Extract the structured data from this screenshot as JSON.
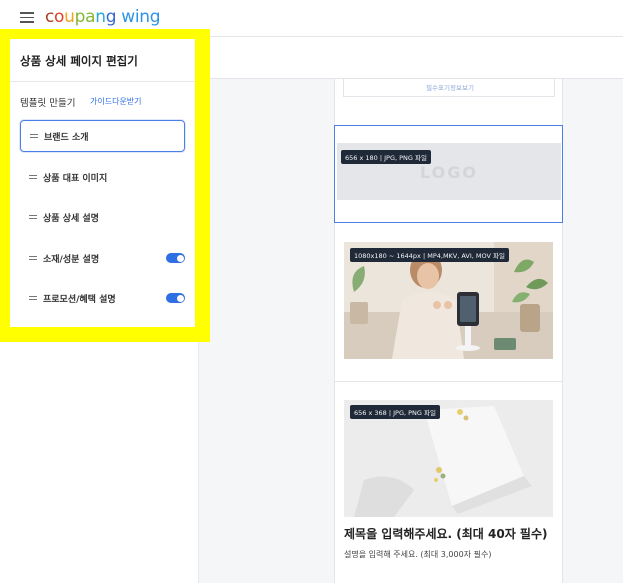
{
  "topbar": {
    "menu_icon": "hamburger-icon",
    "brand": {
      "c1": "c",
      "c2": "o",
      "c3": "u",
      "c4": "pa",
      "c5": "n",
      "c6": "g",
      "wing": "wing"
    }
  },
  "sidebar": {
    "title": "상품 상세 페이지 편집기",
    "template_label": "템플릿 만들기",
    "guide_link": "가이드다운받기",
    "items": [
      {
        "label": "브랜드 소개",
        "active": true,
        "toggle": false
      },
      {
        "label": "상품 대표 이미지",
        "active": false,
        "toggle": false
      },
      {
        "label": "상품 상세 설명",
        "active": false,
        "toggle": false
      },
      {
        "label": "소재/성분 설명",
        "active": false,
        "toggle": true
      },
      {
        "label": "프로모션/혜택 설명",
        "active": false,
        "toggle": true
      }
    ],
    "highlight_color": "#ffff00",
    "toggle_color": "#2f6fe4"
  },
  "preview": {
    "required_info_link": "필수표기정보보기",
    "logo_block": {
      "size_chip": "656 x 180 | JPG, PNG 파일",
      "placeholder": "LOGO"
    },
    "video_block": {
      "size_chip": "1080x180 ~ 1644px  | MP4,MKV, AVI, MOV 파일"
    },
    "image_block": {
      "size_chip": "656 x 368 | JPG, PNG 파일"
    },
    "content_title": "제목을 입력해주세요. (최대 40자 필수)",
    "content_desc": "설명을 입력해 주세요. (최대 3,000자 필수)"
  }
}
